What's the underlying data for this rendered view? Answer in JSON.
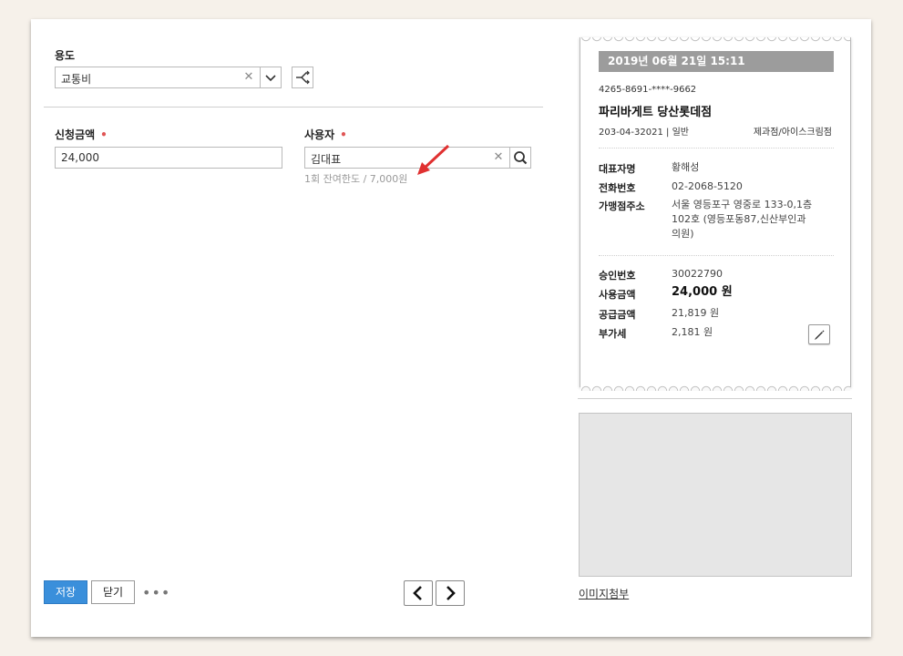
{
  "form": {
    "usage_label": "용도",
    "usage_value": "교통비",
    "amount_label": "신청금액",
    "amount_value": "24,000",
    "user_label": "사용자",
    "user_value": "김대표",
    "required_mark": "•",
    "limit_hint": "1회 잔여한도 / 7,000원"
  },
  "receipt": {
    "datetime": "2019년 06월 21일 15:11",
    "card_number": "4265-8691-****-9662",
    "merchant_name": "파리바게트 당산롯데점",
    "business_no": "203-04-32021 | 일반",
    "category": "제과점/아이스크림점",
    "ceo_key": "대표자명",
    "ceo_val": "황해성",
    "phone_key": "전화번호",
    "phone_val": "02-2068-5120",
    "address_key": "가맹점주소",
    "address_line1": "서울 영등포구 영중로 133-0,1층",
    "address_line2": "102호 (영등포동87,신산부인과",
    "address_line3": "의원)",
    "approval_key": "승인번호",
    "approval_val": "30022790",
    "amount_key": "사용금액",
    "amount_val": "24,000 원",
    "supply_key": "공급금액",
    "supply_val": "21,819 원",
    "vat_key": "부가세",
    "vat_val": "2,181 원"
  },
  "attachment_link": "이미지첨부",
  "buttons": {
    "save": "저장",
    "close": "닫기",
    "more": "•••"
  },
  "icons": {
    "clear": "close-icon",
    "dropdown": "chevron-down-icon",
    "split": "share-icon",
    "search": "search-icon",
    "edit": "pencil-icon",
    "prev": "chevron-left-icon",
    "next": "chevron-right-icon"
  },
  "colors": {
    "primary": "#3a8fdb",
    "required": "#e05555",
    "arrow": "#e03030"
  }
}
